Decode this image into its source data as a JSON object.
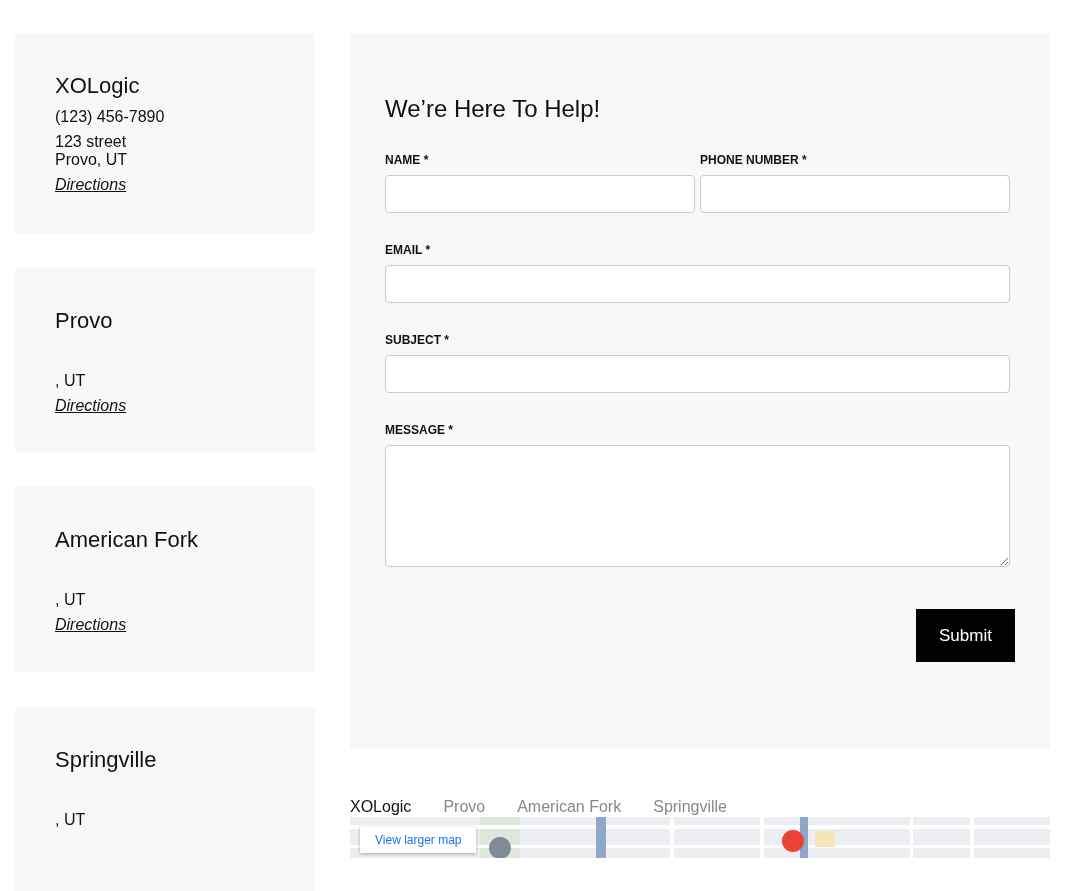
{
  "locations": [
    {
      "name": "XOLogic",
      "phone": "(123) 456-7890",
      "street": "123 street",
      "city_line": "Provo, UT",
      "directions": "Directions"
    },
    {
      "name": "Provo",
      "city_line": ", UT",
      "directions": "Directions"
    },
    {
      "name": "American Fork",
      "city_line": ", UT",
      "directions": "Directions"
    },
    {
      "name": "Springville",
      "city_line": ", UT"
    }
  ],
  "contact_form": {
    "title": "We’re Here To Help!",
    "fields": [
      {
        "kind": "input",
        "label": "NAME *",
        "half": true
      },
      {
        "kind": "input",
        "label": "PHONE NUMBER *",
        "half": true
      },
      {
        "kind": "input",
        "label": "EMAIL *",
        "half": false
      },
      {
        "kind": "input",
        "label": "SUBJECT *",
        "half": false
      },
      {
        "kind": "textarea",
        "label": "MESSAGE *",
        "half": false
      }
    ],
    "submit": "Submit"
  },
  "map_tabs": [
    {
      "label": "XOLogic",
      "selected": true
    },
    {
      "label": "Provo",
      "selected": false
    },
    {
      "label": "American Fork",
      "selected": false
    },
    {
      "label": "Springville",
      "selected": false
    }
  ],
  "map": {
    "kind": "picture",
    "link": "View larger map"
  }
}
